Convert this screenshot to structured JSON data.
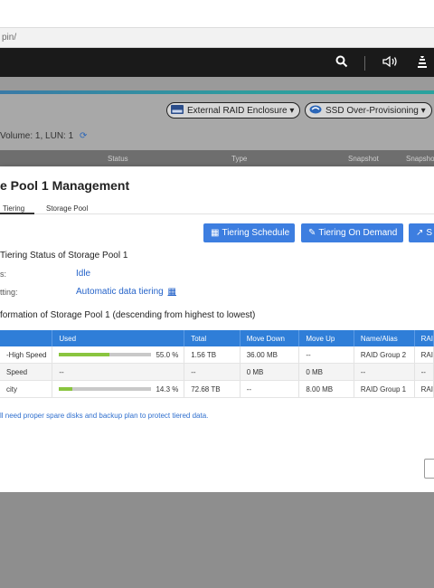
{
  "browser": {
    "url": "pin/"
  },
  "header": {
    "icons": [
      "search-icon",
      "volume-icon",
      "stack-icon"
    ]
  },
  "toolbar": {
    "external_raid": "External RAID Enclosure",
    "ssd_overprovisioning": "SSD Over-Provisioning"
  },
  "background": {
    "volume_line": "Volume: 1, LUN: 1",
    "columns": [
      "Status",
      "Type",
      "Snapshot",
      "Snapshot"
    ]
  },
  "dialog": {
    "title": "e Pool 1 Management",
    "tabs": [
      "Tiering",
      "Storage Pool"
    ],
    "buttons": {
      "schedule": "Tiering Schedule",
      "on_demand": "Tiering On Demand",
      "stats": "S"
    },
    "status_section": "Tiering Status of Storage Pool 1",
    "status_label": "s:",
    "status_value": "Idle",
    "setting_label": "tting:",
    "setting_value": "Automatic data tiering",
    "info_section": "formation of Storage Pool 1 (descending from highest to lowest)",
    "table": {
      "headers": [
        "",
        "Used",
        "Total",
        "Move Down",
        "Move Up",
        "Name/Alias",
        "RAI"
      ],
      "rows": [
        {
          "tier": "-High Speed",
          "used": "",
          "used_pct": "55.0 %",
          "used_fraction": 0.55,
          "total": "1.56 TB",
          "move_down": "36.00 MB",
          "move_up": "--",
          "name": "RAID Group 2",
          "raid": "RAI"
        },
        {
          "tier": "Speed",
          "used": "--",
          "used_pct": "",
          "used_fraction": 0,
          "total": "--",
          "move_down": "0 MB",
          "move_up": "0 MB",
          "name": "--",
          "raid": "--"
        },
        {
          "tier": "city",
          "used": "",
          "used_pct": "14.3 %",
          "used_fraction": 0.143,
          "total": "72.68 TB",
          "move_down": "--",
          "move_up": "8.00 MB",
          "name": "RAID Group 1",
          "raid": "RAI"
        }
      ]
    },
    "note": "ll need proper spare disks and backup plan to protect tiered data."
  },
  "colors": {
    "accent": "#3d7ee0",
    "progress": "#8ac53f",
    "header": "#1a1a1a"
  }
}
